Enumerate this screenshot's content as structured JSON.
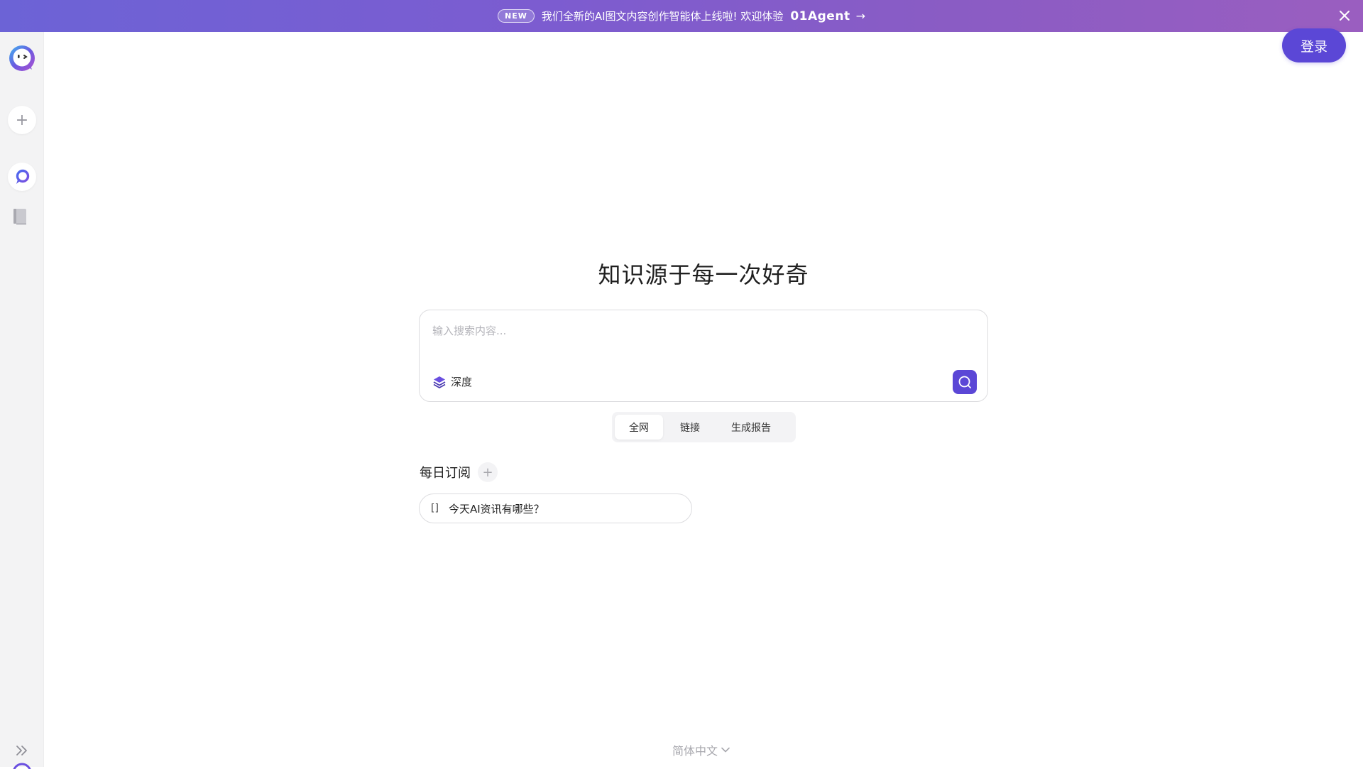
{
  "banner": {
    "badge": "NEW",
    "text": "我们全新的AI图文内容创作智能体上线啦! 欢迎体验",
    "brand": "01Agent",
    "arrow": "→"
  },
  "header": {
    "login_label": "登录"
  },
  "main": {
    "title": "知识源于每一次好奇",
    "search": {
      "placeholder": "输入搜索内容...",
      "value": "",
      "depth_label": "深度"
    },
    "scope_tabs": [
      {
        "label": "全网",
        "active": true
      },
      {
        "label": "链接",
        "active": false
      },
      {
        "label": "生成报告",
        "active": false
      }
    ],
    "daily": {
      "title": "每日订阅",
      "add_symbol": "+",
      "items": [
        {
          "icon_text": "[]",
          "label": "今天AI资讯有哪些？"
        }
      ]
    }
  },
  "sidebar": {
    "new_symbol": "+"
  },
  "footer": {
    "language": "简体中文"
  },
  "colors": {
    "accent": "#5b47d6",
    "banner_start": "#6c63d6",
    "banner_end": "#9a5ec0"
  }
}
